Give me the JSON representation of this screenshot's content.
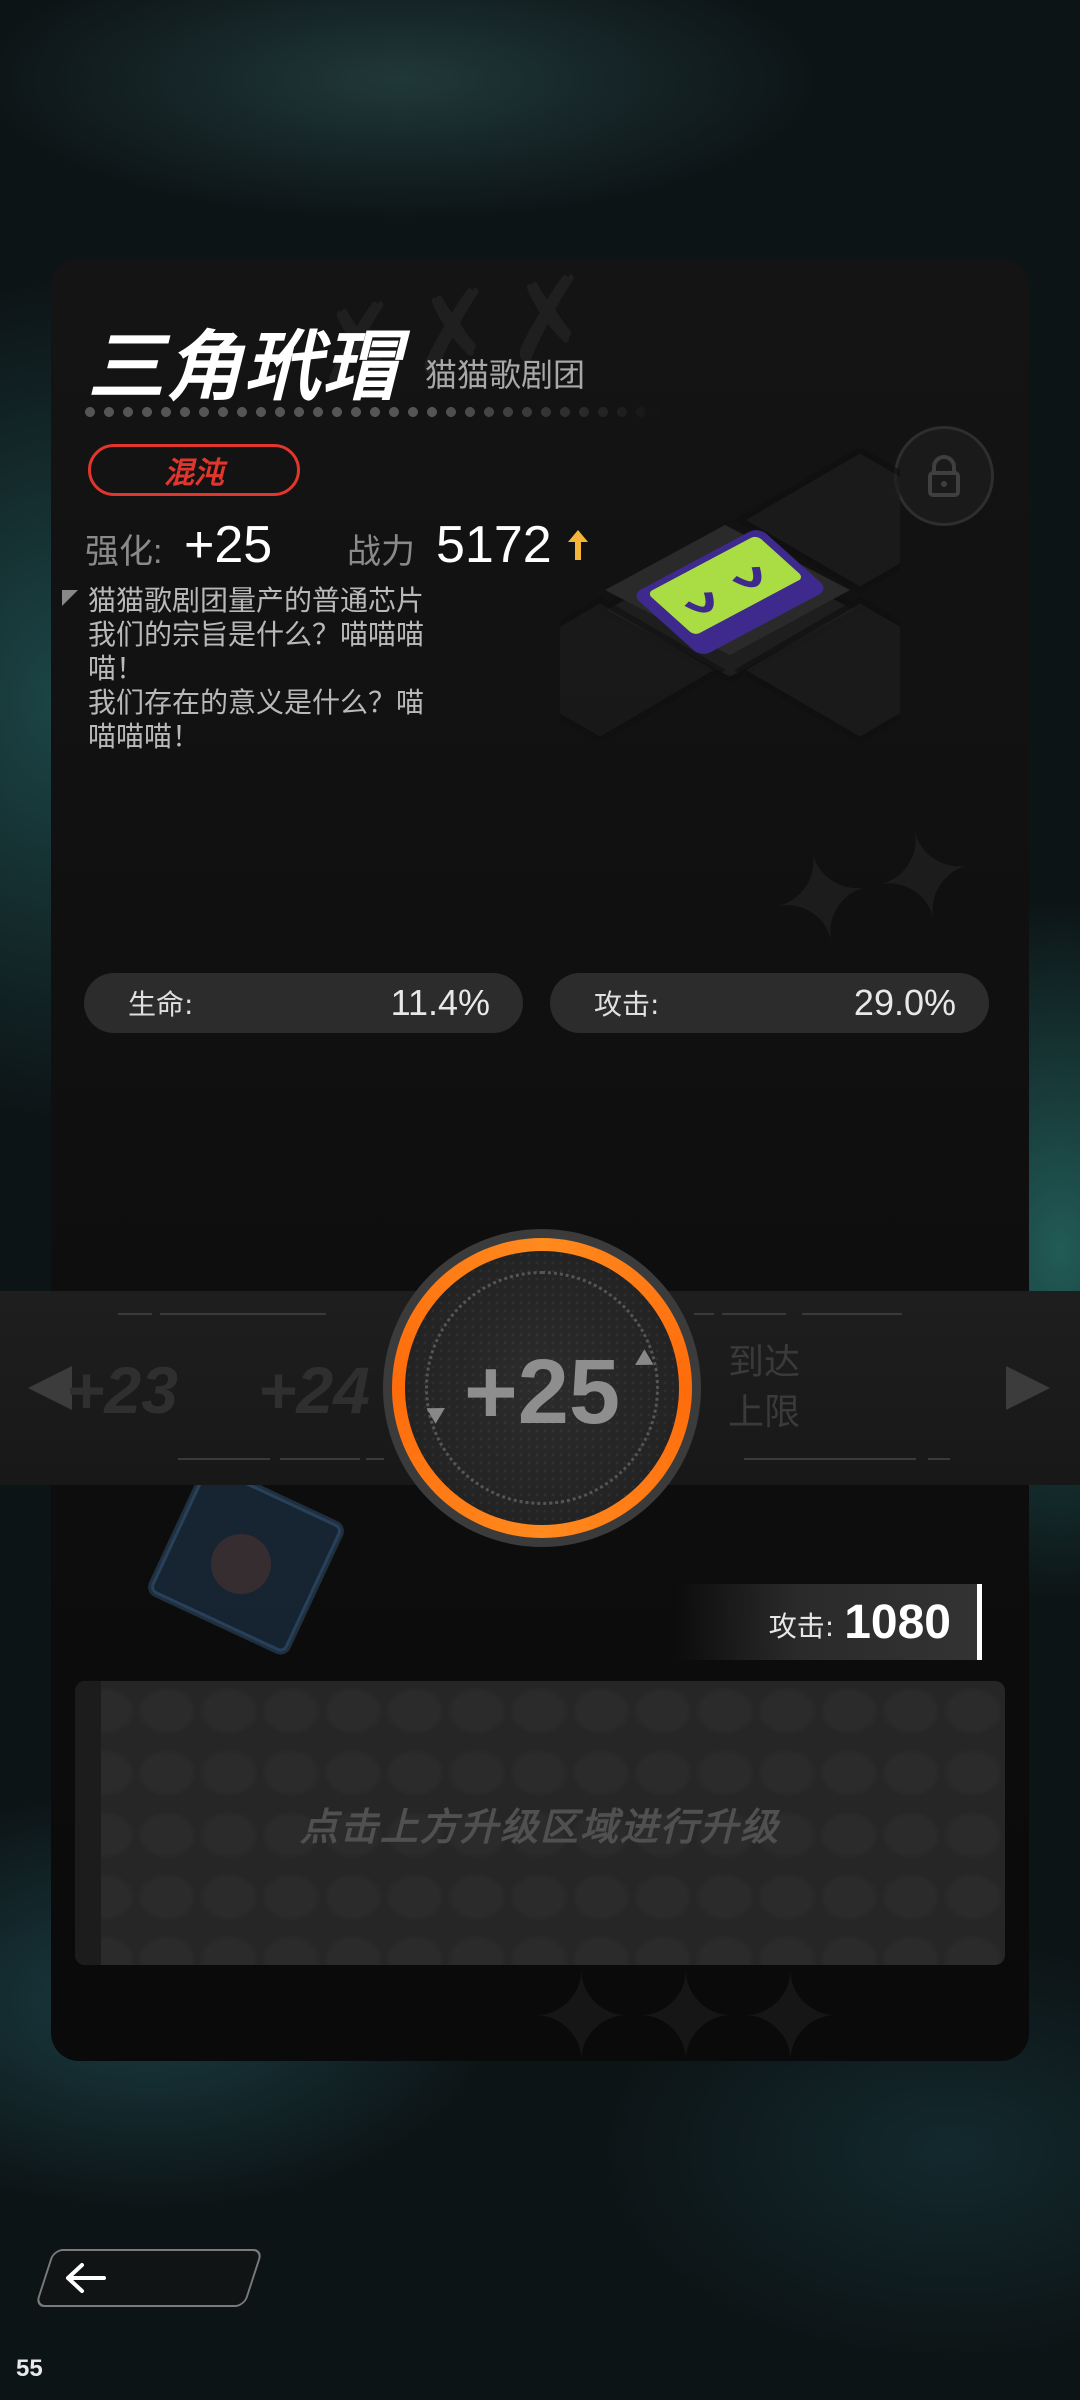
{
  "item": {
    "name": "三角玳瑁",
    "faction": "猫猫歌剧团",
    "rarity": "混沌",
    "description_lines": [
      "猫猫歌剧团量产的普通芯片",
      "我们的宗旨是什么？喵喵喵",
      "喵！",
      "我们存在的意义是什么？喵",
      "喵喵喵！"
    ]
  },
  "stats_line": {
    "enhance_label": "强化:",
    "enhance_value": "+25",
    "power_label": "战力",
    "power_value": "5172",
    "power_trend_icon": "up-arrow-icon"
  },
  "sub_stats": [
    {
      "label": "生命:",
      "value": "11.4%"
    },
    {
      "label": "攻击:",
      "value": "29.0%"
    }
  ],
  "level_selector": {
    "prev2": "+23",
    "prev1": "+24",
    "current": "+25",
    "next": [
      "到达",
      "上限"
    ]
  },
  "main_stat": {
    "label": "攻击:",
    "value": "1080"
  },
  "instruction": "点击上方升级区域进行升级",
  "fps": "55",
  "colors": {
    "accent_orange": "#ff7a12",
    "rarity_red": "#e2362c",
    "arrow_gold": "#f5b53a",
    "chip_green": "#b6f03c",
    "chip_purple": "#3d2a8c"
  }
}
